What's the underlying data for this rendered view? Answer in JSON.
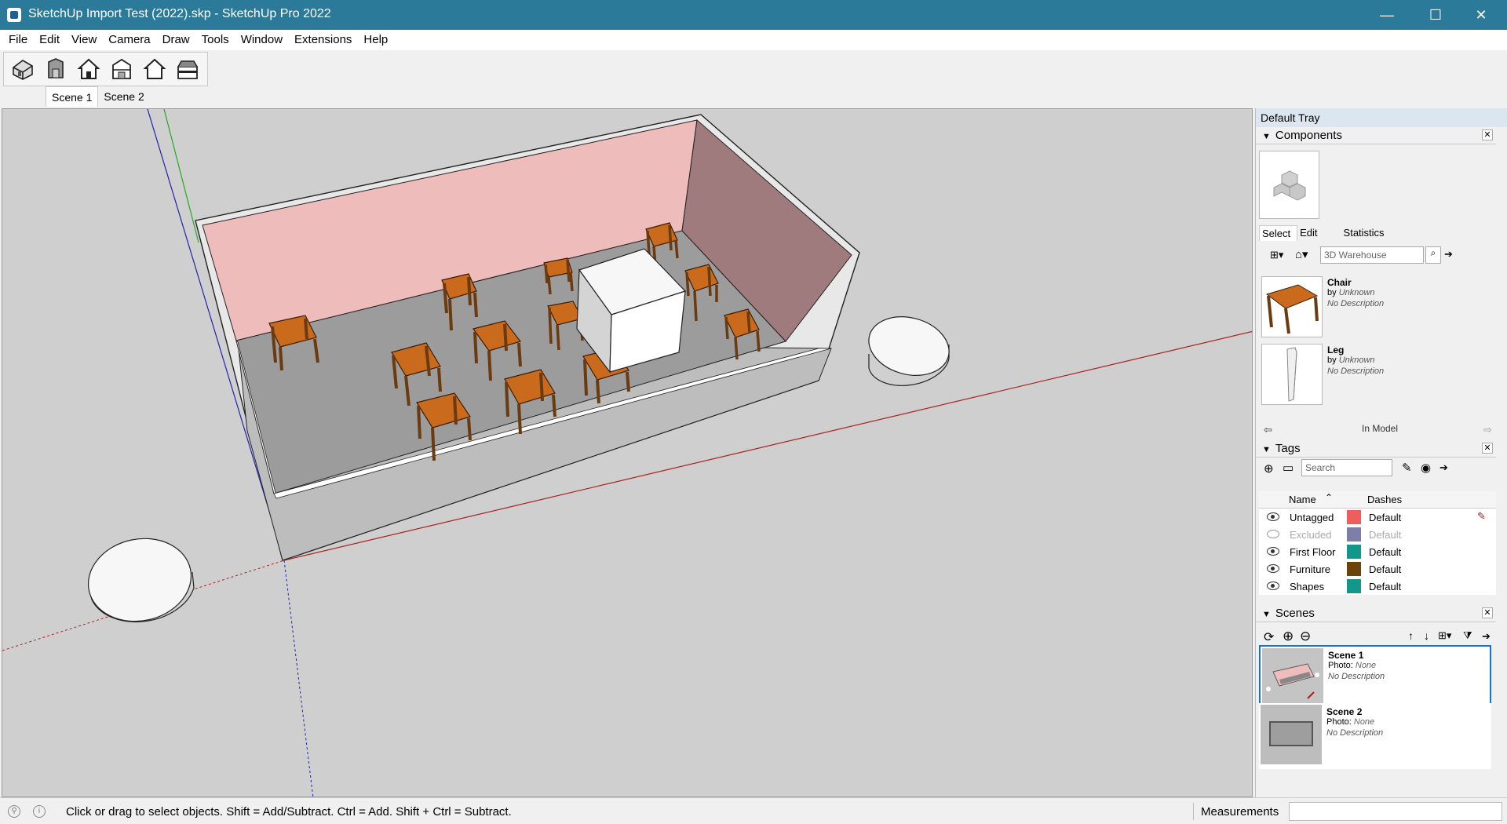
{
  "window": {
    "title": "SketchUp Import Test (2022).skp - SketchUp Pro 2022",
    "minimize": "—",
    "maximize": "☐",
    "close": "✕"
  },
  "menu": [
    "File",
    "Edit",
    "View",
    "Camera",
    "Draw",
    "Tools",
    "Window",
    "Extensions",
    "Help"
  ],
  "toolbar": {
    "tools": [
      "iso-view-icon",
      "front-view-icon",
      "top-view-icon",
      "right-view-icon",
      "back-view-icon",
      "left-view-icon"
    ]
  },
  "scene_tabs": [
    "Scene 1",
    "Scene 2"
  ],
  "tray": {
    "title": "Default Tray",
    "components": {
      "title": "Components",
      "tabs": [
        "Select",
        "Edit",
        "Statistics"
      ],
      "search_placeholder": "3D Warehouse",
      "items": [
        {
          "name": "Chair",
          "by_label": "by",
          "author": "Unknown",
          "description": "No Description"
        },
        {
          "name": "Leg",
          "by_label": "by",
          "author": "Unknown",
          "description": "No Description"
        }
      ],
      "location": "In Model"
    },
    "tags": {
      "title": "Tags",
      "search_placeholder": "Search",
      "col_name": "Name",
      "col_dashes": "Dashes",
      "rows": [
        {
          "name": "Untagged",
          "color": "#f05d5d",
          "dashes": "Default",
          "visible": true
        },
        {
          "name": "Excluded",
          "color": "#7f7daa",
          "dashes": "Default",
          "visible": false
        },
        {
          "name": "First Floor",
          "color": "#13978a",
          "dashes": "Default",
          "visible": true
        },
        {
          "name": "Furniture",
          "color": "#6b4208",
          "dashes": "Default",
          "visible": true
        },
        {
          "name": "Shapes",
          "color": "#13978a",
          "dashes": "Default",
          "visible": true
        }
      ]
    },
    "scenes": {
      "title": "Scenes",
      "items": [
        {
          "name": "Scene 1",
          "photo_label": "Photo:",
          "photo": "None",
          "description": "No Description"
        },
        {
          "name": "Scene 2",
          "photo_label": "Photo:",
          "photo": "None",
          "description": "No Description"
        }
      ]
    }
  },
  "status": {
    "message": "Click or drag to select objects. Shift = Add/Subtract. Ctrl = Add. Shift + Ctrl = Subtract.",
    "measurements_label": "Measurements",
    "measurements_value": ""
  },
  "colors": {
    "titlebar": "#2b7a99",
    "wall_pink": "#efbcbc",
    "wall_dark": "#9f7b7d",
    "table_wood": "#c96a1c",
    "selection_blue": "#1a73c8"
  }
}
